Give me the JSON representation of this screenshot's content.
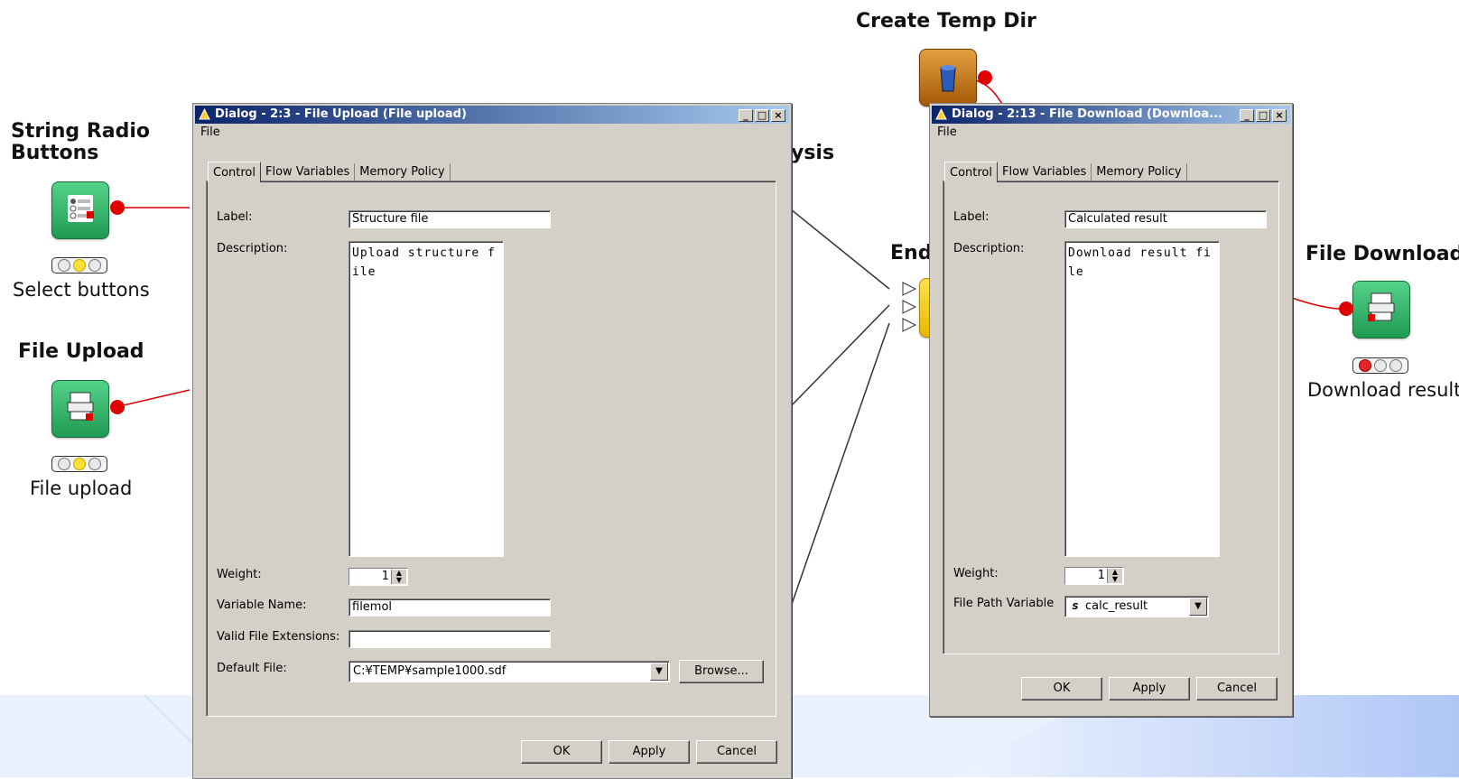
{
  "canvas": {
    "nodes": {
      "radio": {
        "title": "String Radio\nButtons",
        "caption": "Select buttons"
      },
      "upload": {
        "title": "File Upload",
        "caption": "File upload"
      },
      "temp": {
        "title": "Create Temp Dir"
      },
      "end": {
        "title": "End"
      },
      "download": {
        "title": "File Download",
        "caption": "Download result"
      },
      "hidden_fragment": "ysis"
    }
  },
  "dialog_upload": {
    "title": "Dialog - 2:3 - File Upload (File upload)",
    "menu": "File",
    "tabs": [
      "Control",
      "Flow Variables",
      "Memory Policy"
    ],
    "fields": {
      "label_label": "Label:",
      "label_value": "Structure file",
      "description_label": "Description:",
      "description_value": "Upload structure file",
      "weight_label": "Weight:",
      "weight_value": "1",
      "varname_label": "Variable Name:",
      "varname_value": "filemol",
      "ext_label": "Valid File Extensions:",
      "ext_value": "",
      "default_label": "Default File:",
      "default_value": "C:¥TEMP¥sample1000.sdf",
      "browse": "Browse..."
    },
    "buttons": {
      "ok": "OK",
      "apply": "Apply",
      "cancel": "Cancel"
    }
  },
  "dialog_download": {
    "title": "Dialog - 2:13 - File Download (Downloa...",
    "menu": "File",
    "tabs": [
      "Control",
      "Flow Variables",
      "Memory Policy"
    ],
    "fields": {
      "label_label": "Label:",
      "label_value": "Calculated result",
      "description_label": "Description:",
      "description_value": "Download result file",
      "weight_label": "Weight:",
      "weight_value": "1",
      "pathvar_label": "File Path Variable",
      "pathvar_value": "calc_result",
      "pathvar_type_glyph": "S"
    },
    "buttons": {
      "ok": "OK",
      "apply": "Apply",
      "cancel": "Cancel"
    }
  },
  "colors": {
    "node_green": "#1f9a52",
    "port_red": "#e00000",
    "titlebar_start": "#0a246a",
    "titlebar_end": "#a6caf0",
    "dialog_bg": "#d4d0c8"
  }
}
